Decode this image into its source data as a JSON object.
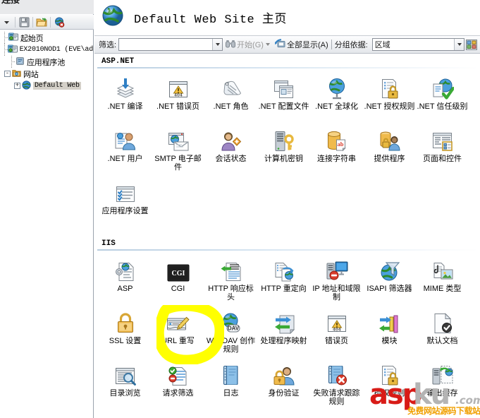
{
  "window": {
    "connections_title": "连接"
  },
  "connections_toolbar": {
    "items": [
      {
        "name": "back-dropdown-icon",
        "glyph": "▾"
      },
      {
        "name": "save-icon",
        "glyph": "save"
      },
      {
        "name": "open-folder-icon",
        "glyph": "folder"
      },
      {
        "name": "disconnect-icon",
        "glyph": "globe-x"
      }
    ]
  },
  "tree": {
    "nodes": [
      {
        "label": "起始页",
        "icon": "start-page-icon",
        "indent": 0,
        "expander": "",
        "selected": false,
        "mono": false
      },
      {
        "label": "EX2010NOD1  (EVE\\ad",
        "icon": "server-icon",
        "indent": 0,
        "expander": "",
        "selected": false,
        "mono": true
      },
      {
        "label": "应用程序池",
        "icon": "app-pools-icon",
        "indent": 1,
        "expander": "",
        "selected": false,
        "mono": false
      },
      {
        "label": "网站",
        "icon": "sites-folder-icon",
        "indent": 1,
        "expander": "-",
        "selected": false,
        "mono": false
      },
      {
        "label": "Default Web",
        "icon": "website-icon",
        "indent": 2,
        "expander": "+",
        "selected": true,
        "mono": true
      }
    ]
  },
  "header": {
    "icon": "website-globe-icon",
    "title": "Default Web Site 主页"
  },
  "filter_bar": {
    "filter_label": "筛选:",
    "filter_value": "",
    "filter_placeholder": "",
    "start_label": "开始(G)",
    "show_all_label": "全部显示(A)",
    "group_by_label": "分组依据:",
    "group_by_value": "区域",
    "view_icon": "view-tiles-icon"
  },
  "sections": [
    {
      "id": "aspnet",
      "title": "ASP.NET",
      "items": [
        {
          "label": ".NET 编译",
          "icon": "net-compilation-icon"
        },
        {
          "label": ".NET 错误页",
          "icon": "net-error-pages-icon"
        },
        {
          "label": ".NET 角色",
          "icon": "net-roles-icon"
        },
        {
          "label": ".NET 配置文件",
          "icon": "net-profile-icon"
        },
        {
          "label": ".NET 全球化",
          "icon": "net-globalization-icon"
        },
        {
          "label": ".NET 授权规则",
          "icon": "net-authorization-rules-icon"
        },
        {
          "label": ".NET 信任级别",
          "icon": "net-trust-levels-icon"
        },
        {
          "label": ".NET 用户",
          "icon": "net-users-icon"
        },
        {
          "label": "SMTP 电子邮件",
          "icon": "smtp-email-icon"
        },
        {
          "label": "会话状态",
          "icon": "session-state-icon"
        },
        {
          "label": "计算机密钥",
          "icon": "machine-key-icon"
        },
        {
          "label": "连接字符串",
          "icon": "connection-strings-icon"
        },
        {
          "label": "提供程序",
          "icon": "providers-icon"
        },
        {
          "label": "页面和控件",
          "icon": "pages-and-controls-icon"
        },
        {
          "label": "应用程序设置",
          "icon": "application-settings-icon"
        }
      ]
    },
    {
      "id": "iis",
      "title": "IIS",
      "items": [
        {
          "label": "ASP",
          "icon": "asp-icon"
        },
        {
          "label": "CGI",
          "icon": "cgi-icon"
        },
        {
          "label": "HTTP 响应标头",
          "icon": "http-response-headers-icon"
        },
        {
          "label": "HTTP 重定向",
          "icon": "http-redirect-icon"
        },
        {
          "label": "IP 地址和域限制",
          "icon": "ip-address-domain-restrictions-icon"
        },
        {
          "label": "ISAPI 筛选器",
          "icon": "isapi-filters-icon"
        },
        {
          "label": "MIME 类型",
          "icon": "mime-types-icon"
        },
        {
          "label": "SSL 设置",
          "icon": "ssl-settings-icon"
        },
        {
          "label": "URL 重写",
          "icon": "url-rewrite-icon"
        },
        {
          "label": "WebDAV 创作规则",
          "icon": "webdav-authoring-rules-icon"
        },
        {
          "label": "处理程序映射",
          "icon": "handler-mappings-icon"
        },
        {
          "label": "错误页",
          "icon": "error-pages-icon"
        },
        {
          "label": "模块",
          "icon": "modules-icon"
        },
        {
          "label": "默认文档",
          "icon": "default-document-icon"
        },
        {
          "label": "目录浏览",
          "icon": "directory-browsing-icon"
        },
        {
          "label": "请求筛选",
          "icon": "request-filtering-icon"
        },
        {
          "label": "日志",
          "icon": "logging-icon"
        },
        {
          "label": "身份验证",
          "icon": "authentication-icon"
        },
        {
          "label": "失败请求跟踪规则",
          "icon": "failed-request-tracing-rules-icon"
        },
        {
          "label": "授权规则",
          "icon": "authorization-rules-icon"
        },
        {
          "label": "输出缓存",
          "icon": "output-caching-icon"
        }
      ]
    }
  ],
  "annotation": {
    "highlight_target": "URL 重写",
    "highlight_color": "#ffff00"
  },
  "watermark": {
    "part1": "asp",
    "part2": "ku",
    "part3": ".com",
    "tagline": "免费网站源码下载站",
    "color1": "#d81b17",
    "color2": "#b4b4b4",
    "color3": "#f0a000"
  }
}
